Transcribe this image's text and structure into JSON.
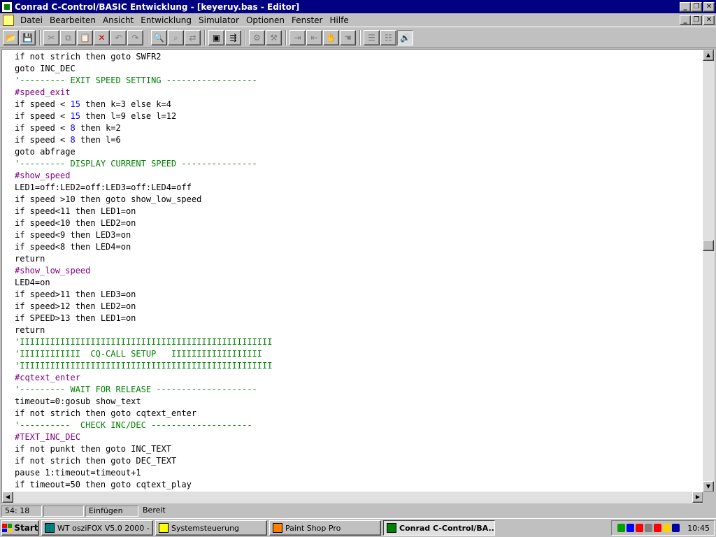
{
  "window": {
    "title": "Conrad C-Control/BASIC Entwicklung - [keyeruy.bas - Editor]",
    "buttons": [
      "_",
      "❐",
      "✕"
    ]
  },
  "menu": {
    "items": [
      "Datei",
      "Bearbeiten",
      "Ansicht",
      "Entwicklung",
      "Simulator",
      "Optionen",
      "Fenster",
      "Hilfe"
    ],
    "doc_buttons": [
      "_",
      "❐",
      "✕"
    ]
  },
  "toolbar": {
    "buttons": [
      {
        "name": "open-icon",
        "glyph": "📂",
        "enabled": true
      },
      {
        "name": "save-icon",
        "glyph": "💾",
        "enabled": false
      },
      {
        "sep": true
      },
      {
        "name": "cut-icon",
        "glyph": "✂",
        "enabled": false
      },
      {
        "name": "copy-icon",
        "glyph": "⧉",
        "enabled": false
      },
      {
        "name": "paste-icon",
        "glyph": "📋",
        "enabled": false
      },
      {
        "name": "delete-icon",
        "glyph": "✕",
        "enabled": true,
        "color": "#c00000"
      },
      {
        "name": "undo-icon",
        "glyph": "↶",
        "enabled": false
      },
      {
        "name": "redo-icon",
        "glyph": "↷",
        "enabled": false
      },
      {
        "sep": true
      },
      {
        "name": "find-icon",
        "glyph": "🔍",
        "enabled": true
      },
      {
        "name": "find-next-icon",
        "glyph": "⌕",
        "enabled": false
      },
      {
        "name": "replace-icon",
        "glyph": "⇄",
        "enabled": false
      },
      {
        "sep": true
      },
      {
        "name": "compile-icon",
        "glyph": "▣",
        "enabled": true
      },
      {
        "name": "transfer-icon",
        "glyph": "⇶",
        "enabled": true
      },
      {
        "sep": true
      },
      {
        "name": "debug-icon",
        "glyph": "⚙",
        "enabled": false
      },
      {
        "name": "debug-step-icon",
        "glyph": "⚒",
        "enabled": false
      },
      {
        "sep": true
      },
      {
        "name": "indent-icon",
        "glyph": "⇥",
        "enabled": false
      },
      {
        "name": "outdent-icon",
        "glyph": "⇤",
        "enabled": false
      },
      {
        "name": "stop-hand-icon",
        "glyph": "✋",
        "enabled": true
      },
      {
        "name": "hand-icon",
        "glyph": "☚",
        "enabled": false
      },
      {
        "sep": true
      },
      {
        "name": "list-icon",
        "glyph": "☰",
        "enabled": false
      },
      {
        "name": "list2-icon",
        "glyph": "☷",
        "enabled": false
      },
      {
        "name": "speaker-icon",
        "glyph": "🔊",
        "enabled": true,
        "pressed": true
      }
    ]
  },
  "editor": {
    "lines": [
      [
        [
          "kw",
          "if not strich then goto SWFR2"
        ]
      ],
      [
        [
          "kw",
          "goto INC_DEC"
        ]
      ],
      [
        [
          "cmt",
          "'--------- EXIT SPEED SETTING ------------------"
        ]
      ],
      [
        [
          "label",
          "#speed_exit"
        ]
      ],
      [
        [
          "kw",
          "if speed < "
        ],
        [
          "num",
          "15"
        ],
        [
          "kw",
          " then k=3 else k=4"
        ]
      ],
      [
        [
          "kw",
          "if speed < "
        ],
        [
          "num",
          "15"
        ],
        [
          "kw",
          " then l=9 else l=12"
        ]
      ],
      [
        [
          "kw",
          "if speed < "
        ],
        [
          "num",
          "8"
        ],
        [
          "kw",
          " then k=2"
        ]
      ],
      [
        [
          "kw",
          "if speed < "
        ],
        [
          "num",
          "8"
        ],
        [
          "kw",
          " then l=6"
        ]
      ],
      [
        [
          "kw",
          "goto abfrage"
        ]
      ],
      [
        [
          "cmt",
          "'--------- DISPLAY CURRENT SPEED ---------------"
        ]
      ],
      [
        [
          "label",
          "#show_speed"
        ]
      ],
      [
        [
          "kw",
          "LED1=off:LED2=off:LED3=off:LED4=off"
        ]
      ],
      [
        [
          "kw",
          "if speed >10 then goto show_low_speed"
        ]
      ],
      [
        [
          "kw",
          "if speed<11 then LED1=on"
        ]
      ],
      [
        [
          "kw",
          "if speed<10 then LED2=on"
        ]
      ],
      [
        [
          "kw",
          "if speed<9 then LED3=on"
        ]
      ],
      [
        [
          "kw",
          "if speed<8 then LED4=on"
        ]
      ],
      [
        [
          "kw",
          "return"
        ]
      ],
      [
        [
          "label",
          "#show_low_speed"
        ]
      ],
      [
        [
          "kw",
          "LED4=on"
        ]
      ],
      [
        [
          "kw",
          "if speed>11 then LED3=on"
        ]
      ],
      [
        [
          "kw",
          "if speed>12 then LED2=on"
        ]
      ],
      [
        [
          "kw",
          "if SPEED>13 then LED1=on"
        ]
      ],
      [
        [
          "kw",
          "return"
        ]
      ],
      [
        [
          "cmt",
          "'IIIIIIIIIIIIIIIIIIIIIIIIIIIIIIIIIIIIIIIIIIIIIIIIII"
        ]
      ],
      [
        [
          "cmt",
          "'IIIIIIIIIIII  CQ-CALL SETUP   IIIIIIIIIIIIIIIIII"
        ]
      ],
      [
        [
          "cmt",
          "'IIIIIIIIIIIIIIIIIIIIIIIIIIIIIIIIIIIIIIIIIIIIIIIIII"
        ]
      ],
      [
        [
          "label",
          "#cqtext_enter"
        ]
      ],
      [
        [
          "cmt",
          "'--------- WAIT FOR RELEASE --------------------"
        ]
      ],
      [
        [
          "kw",
          "timeout=0:gosub show_text"
        ]
      ],
      [
        [
          "kw",
          "if not strich then goto cqtext_enter"
        ]
      ],
      [
        [
          "cmt",
          "'----------  CHECK INC/DEC --------------------"
        ]
      ],
      [
        [
          "label",
          "#TEXT_INC_DEC"
        ]
      ],
      [
        [
          "kw",
          "if not punkt then goto INC_TEXT"
        ]
      ],
      [
        [
          "kw",
          "if not strich then goto DEC_TEXT"
        ]
      ],
      [
        [
          "kw",
          "pause 1:timeout=timeout+1"
        ]
      ],
      [
        [
          "kw",
          "if timeout=50 then goto cqtext_play"
        ]
      ]
    ]
  },
  "status": {
    "position": "54: 18",
    "empty": "",
    "mode": "Einfügen",
    "state": "Bereit"
  },
  "taskbar": {
    "start": "Start",
    "tasks": [
      {
        "label": "WT osziFOX V5.0 2000 - ...",
        "icon_color": "#008080",
        "active": false
      },
      {
        "label": "Systemsteuerung",
        "icon_color": "#ffff00",
        "active": false
      },
      {
        "label": "Paint Shop Pro",
        "icon_color": "#ff8000",
        "active": false
      },
      {
        "label": "Conrad C-Control/BA...",
        "icon_color": "#008000",
        "active": true
      }
    ],
    "clock": "10:45",
    "tray_colors": [
      "#00a000",
      "#0000ff",
      "#ff0000",
      "#808080",
      "#ff0000",
      "#ffd000",
      "#0000a0"
    ]
  },
  "colors": {
    "titlebar": "#000080",
    "comment": "#008000",
    "label": "#800080",
    "number": "#0000ff"
  }
}
